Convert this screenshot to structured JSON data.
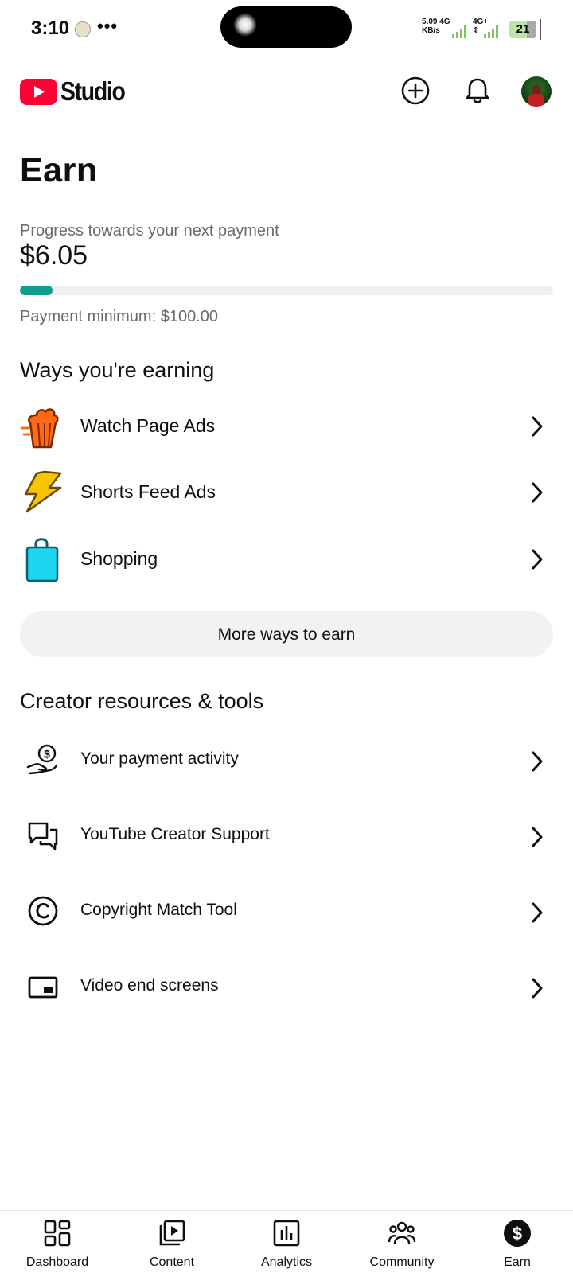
{
  "status_bar": {
    "time": "3:10",
    "dots": "•••",
    "net_speed_value": "5.09",
    "net_speed_unit": "KB/s",
    "net_type_1": "4G",
    "net_type_2": "4G+",
    "battery": "21",
    "battery_level": 0.21
  },
  "header": {
    "app_name": "Studio",
    "icons": [
      "youtube-logo",
      "create-icon",
      "notifications-icon",
      "account-avatar"
    ]
  },
  "earn": {
    "title": "Earn",
    "progress_label": "Progress towards your next payment",
    "amount": "$6.05",
    "progress_fraction": 0.0605,
    "minimum": "Payment minimum: $100.00"
  },
  "ways": {
    "heading": "Ways you're earning",
    "items": [
      {
        "label": "Watch Page Ads",
        "icon": "popcorn-icon"
      },
      {
        "label": "Shorts Feed Ads",
        "icon": "lightning-icon"
      },
      {
        "label": "Shopping",
        "icon": "shopping-bag-icon"
      }
    ],
    "more_button": "More ways to earn"
  },
  "resources": {
    "heading": "Creator resources & tools",
    "items": [
      {
        "label": "Your payment activity",
        "icon": "payment-hand-icon"
      },
      {
        "label": "YouTube Creator Support",
        "icon": "chat-bubbles-icon"
      },
      {
        "label": "Copyright Match Tool",
        "icon": "copyright-icon"
      },
      {
        "label": "Video end screens",
        "icon": "end-screen-icon"
      }
    ]
  },
  "bottom_nav": {
    "items": [
      {
        "label": "Dashboard",
        "icon": "dashboard-icon"
      },
      {
        "label": "Content",
        "icon": "content-icon"
      },
      {
        "label": "Analytics",
        "icon": "analytics-icon"
      },
      {
        "label": "Community",
        "icon": "community-icon"
      },
      {
        "label": "Earn",
        "icon": "earn-icon",
        "active": true
      }
    ]
  },
  "colors": {
    "youtube_red": "#ff0033",
    "progress_fill": "#0f9d8d",
    "progress_track": "#f0f0f0",
    "button_bg": "#f2f2f2"
  }
}
